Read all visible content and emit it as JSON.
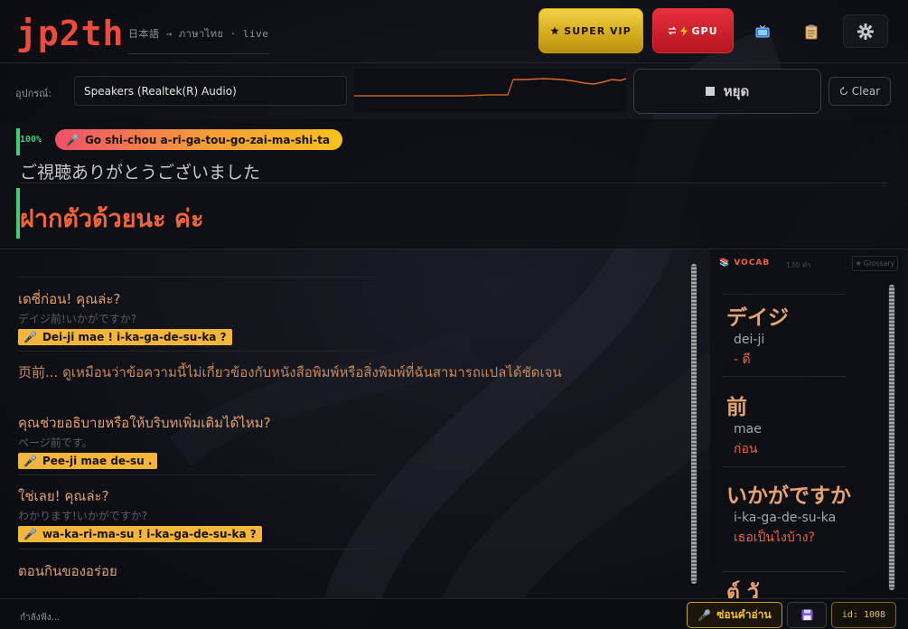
{
  "app": {
    "logo": "jp2th",
    "lang_source": "日本語",
    "lang_arrow": "→",
    "lang_target": "ภาษาไทย",
    "lang_dot": "·",
    "lang_mode": "live"
  },
  "header": {
    "vip_label": "SUPER VIP",
    "gpu_label": "GPU",
    "icons": [
      "star-icon",
      "swap-icon",
      "bolt-icon",
      "tv-icon",
      "clipboard-icon",
      "gear-icon"
    ]
  },
  "device": {
    "label": "อุปกรณ์:",
    "selected": "Speakers (Realtek(R) Audio)",
    "stop_label": "หยุด",
    "clear_label": "Clear"
  },
  "live": {
    "confidence": "100%",
    "romaji": "Go shi-chou a-ri-ga-tou-go-zai-ma-shi-ta",
    "japanese": "ご視聴ありがとうございました",
    "thai": "ฝากตัวด้วยนะ ค่ะ"
  },
  "history": [
    {
      "thai": "เดซี่ก่อน! คุณล่ะ?",
      "japanese": "デイジ前!いかがですか?",
      "romaji": "Dei-ji mae ! i-ka-ga-de-su-ka ?"
    },
    {
      "long": "页前... ดูเหมือนว่าข้อความนี้ไม่เกี่ยวข้องกับหนังสือพิมพ์หรือสิ่งพิมพ์ที่ฉันสามารถแปลได้ชัดเจน"
    },
    {
      "thai": "คุณช่วยอธิบายหรือให้บริบทเพิ่มเติมได้ไหม?",
      "japanese": "ページ前です。",
      "romaji": "Pee-ji mae de-su ."
    },
    {
      "thai": "ใช่เลย! คุณล่ะ?",
      "japanese": "わかります!いかがですか?",
      "romaji": "wa-ka-ri-ma-su ! i-ka-ga-de-su-ka ?"
    },
    {
      "thai": "ตอนกินของอร่อย"
    }
  ],
  "vocab": {
    "title": "VOCAB",
    "count": "130 คำ",
    "glossary_label": "Glossary",
    "items": [
      {
        "word": "デイジ",
        "romaji": "dei-ji",
        "meaning": "- ดี"
      },
      {
        "word": "前",
        "romaji": "mae",
        "meaning": "ก่อน"
      },
      {
        "word": "いかがですか",
        "romaji": "i-ka-ga-de-su-ka",
        "meaning": "เธอเป็นไงบ้าง?"
      },
      {
        "word": "ต์ วั",
        "romaji": "",
        "meaning": ""
      }
    ]
  },
  "footer": {
    "status": "กำลังฟัง...",
    "hide_label": "ซ่อนคำอ่าน",
    "id_label": "id: 1008"
  },
  "colors": {
    "accent": "#f0643a",
    "logo": "#f04a3c",
    "vip": "#f2d24a",
    "gpu": "#e8303e",
    "live_ok": "#3ad07a",
    "romaji_bg": "#f4b63a"
  }
}
